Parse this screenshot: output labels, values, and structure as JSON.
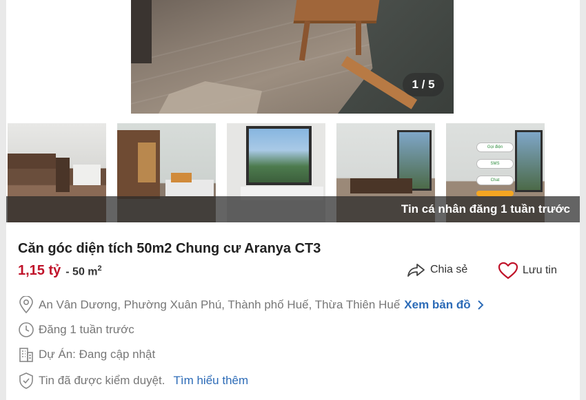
{
  "gallery": {
    "counter": "1 / 5",
    "badge": "Tin cá nhân đăng 1 tuần trước",
    "thumb_buttons": [
      "Gọi điện",
      "SMS",
      "Chat"
    ]
  },
  "listing": {
    "title": "Căn góc diện tích 50m2 Chung cư Aranya CT3",
    "price": "1,15 tỷ",
    "area_prefix": "- 50 m",
    "area_unit_sup": "2",
    "share_label": "Chia sẻ",
    "save_label": "Lưu tin"
  },
  "details": {
    "address": "An Vân Dương, Phường Xuân Phú, Thành phố Huế, Thừa Thiên Huế",
    "map_link": "Xem bản đồ",
    "posted": "Đăng 1 tuần trước",
    "project": "Dự Án: Đang cập nhật",
    "verified": "Tin đã được kiểm duyệt.",
    "learn_more": "Tìm hiểu thêm"
  },
  "colors": {
    "price": "#c0132a",
    "link": "#2c6bb7",
    "heart": "#c0132a"
  },
  "icons": [
    "share-icon",
    "heart-icon",
    "location-pin-icon",
    "clock-icon",
    "building-icon",
    "shield-check-icon",
    "chevron-right-icon"
  ]
}
